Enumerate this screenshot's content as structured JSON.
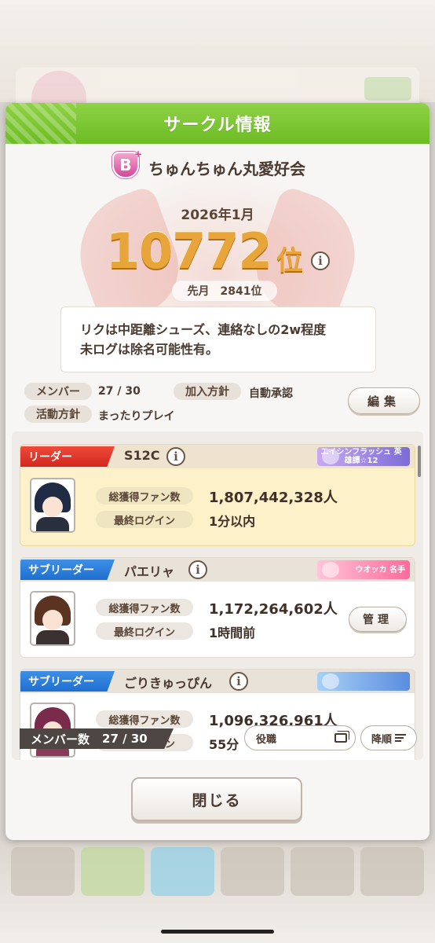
{
  "dialog": {
    "title": "サークル情報",
    "circle_rank_letter": "B",
    "circle_rank_plus": "+",
    "circle_name": "ちゅんちゅん丸愛好会",
    "ranking_month": "2026年1月",
    "ranking_value": "10772",
    "ranking_suffix": "位",
    "info_symbol": "i",
    "prev_month_label": "先月",
    "prev_month_rank": "2841位",
    "description": "リクは中距離シューズ、連絡なしの2w程度\n未ログは除名可能性有。",
    "meta": {
      "members_label": "メンバー",
      "members_value": "27 / 30",
      "join_policy_label": "加入方針",
      "join_policy_value": "自動承認",
      "activity_label": "活動方針",
      "activity_value": "まったりプレイ",
      "edit_label": "編集"
    },
    "members": [
      {
        "role": "リーダー",
        "name": "S12C",
        "title_badge": "エイシンフラッシュ 英雄譚☆12",
        "fans_label": "総獲得ファン数",
        "fans_value": "1,807,442,328人",
        "login_label": "最終ログイン",
        "login_value": "1分以内"
      },
      {
        "role": "サブリーダー",
        "name": "パエリャ",
        "title_badge": "ウオッカ 名手",
        "fans_label": "総獲得ファン数",
        "fans_value": "1,172,264,602人",
        "login_label": "最終ログイン",
        "login_value": "1時間前",
        "manage_label": "管理"
      },
      {
        "role": "サブリーダー",
        "name": "ごりきゅっぴん",
        "title_badge": "",
        "fans_label": "総獲得ファン数",
        "fans_value": "1,096,326,961人",
        "login_label": "最終ログイン",
        "login_value": "55分"
      }
    ],
    "member_count_label": "メンバー数",
    "member_count_value": "27 / 30",
    "sort_label": "役職",
    "order_label": "降順",
    "close_label": "閉じる"
  },
  "colors": {
    "header_green": "#7cc733",
    "leader_red": "#e0362b",
    "sub_blue": "#2f7fdc",
    "rank_gold": "#e8a53a"
  }
}
